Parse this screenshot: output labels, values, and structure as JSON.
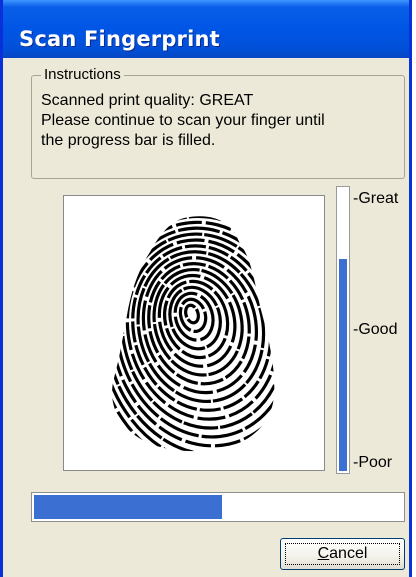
{
  "window": {
    "title": "Scan Fingerprint"
  },
  "instructions": {
    "legend": "Instructions",
    "line1": "Scanned print quality: GREAT",
    "line2": "Please continue to scan your finger until",
    "line3": "the progress bar is filled."
  },
  "quality_meter": {
    "label_top": "-Great",
    "label_mid": "-Good",
    "label_bottom": "-Poor",
    "level_fraction": 0.75
  },
  "scan_progress": {
    "fraction": 0.51
  },
  "buttons": {
    "cancel_prefix": "",
    "cancel_mnemonic": "C",
    "cancel_rest": "ancel"
  },
  "colors": {
    "titlebar": "#0055e5",
    "dialog_bg": "#ece9d8",
    "bar_fill": "#3b6fd2"
  },
  "icons": {
    "fingerprint": "fingerprint-image"
  }
}
